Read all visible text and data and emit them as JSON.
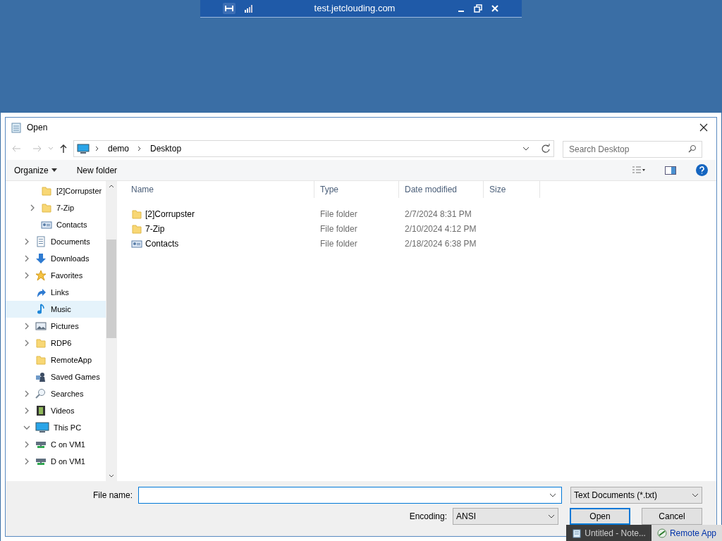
{
  "remote_bar": {
    "host": "test.jetclouding.com"
  },
  "dialog": {
    "title": "Open"
  },
  "address": {
    "crumbs": [
      "demo",
      "Desktop"
    ],
    "search_placeholder": "Search Desktop"
  },
  "toolbar": {
    "organize": "Organize",
    "new_folder": "New folder"
  },
  "nav": {
    "nested_items": [
      {
        "label": "[2]Corrupster",
        "kind": "folder",
        "expandable": false,
        "hovered": false
      },
      {
        "label": "7-Zip",
        "kind": "folder",
        "expandable": true,
        "expanded": false,
        "hovered": false
      },
      {
        "label": "Contacts",
        "kind": "contacts",
        "expandable": false,
        "hovered": false
      }
    ],
    "items": [
      {
        "label": "Documents",
        "kind": "documents",
        "expandable": true,
        "expanded": false,
        "hovered": false
      },
      {
        "label": "Downloads",
        "kind": "downloads",
        "expandable": true,
        "expanded": false,
        "hovered": false
      },
      {
        "label": "Favorites",
        "kind": "favorites",
        "expandable": true,
        "expanded": false,
        "hovered": false
      },
      {
        "label": "Links",
        "kind": "links",
        "expandable": false,
        "hovered": false
      },
      {
        "label": "Music",
        "kind": "music",
        "expandable": false,
        "hovered": true
      },
      {
        "label": "Pictures",
        "kind": "pictures",
        "expandable": true,
        "expanded": false,
        "hovered": false
      },
      {
        "label": "RDP6",
        "kind": "folder",
        "expandable": true,
        "expanded": false,
        "hovered": false
      },
      {
        "label": "RemoteApp",
        "kind": "folder",
        "expandable": false,
        "hovered": false
      },
      {
        "label": "Saved Games",
        "kind": "games",
        "expandable": false,
        "hovered": false
      },
      {
        "label": "Searches",
        "kind": "searches",
        "expandable": true,
        "expanded": false,
        "hovered": false
      },
      {
        "label": "Videos",
        "kind": "videos",
        "expandable": true,
        "expanded": false,
        "hovered": false
      },
      {
        "label": "This PC",
        "kind": "pc",
        "expandable": true,
        "expanded": true,
        "hovered": false,
        "children": [
          {
            "label": "C on VM1",
            "kind": "drive",
            "expandable": true,
            "expanded": false,
            "hovered": false
          },
          {
            "label": "D on VM1",
            "kind": "drive",
            "expandable": true,
            "expanded": false,
            "hovered": false
          }
        ]
      }
    ]
  },
  "table": {
    "columns": [
      "Name",
      "Type",
      "Date modified",
      "Size"
    ],
    "rows": [
      {
        "name": "[2]Corrupster",
        "kind": "folder",
        "type": "File folder",
        "date": "2/7/2024 8:31 PM"
      },
      {
        "name": "7-Zip",
        "kind": "folder",
        "type": "File folder",
        "date": "2/10/2024 4:12 PM"
      },
      {
        "name": "Contacts",
        "kind": "contacts",
        "type": "File folder",
        "date": "2/18/2024 6:38 PM"
      }
    ]
  },
  "footer": {
    "file_name_label": "File name:",
    "file_type": "Text Documents (*.txt)",
    "encoding_label": "Encoding:",
    "encoding": "ANSI",
    "open": "Open",
    "cancel": "Cancel"
  },
  "taskbar": [
    {
      "label": "Untitled - Note...",
      "active": true
    },
    {
      "label": "Remote App",
      "active": false
    }
  ]
}
